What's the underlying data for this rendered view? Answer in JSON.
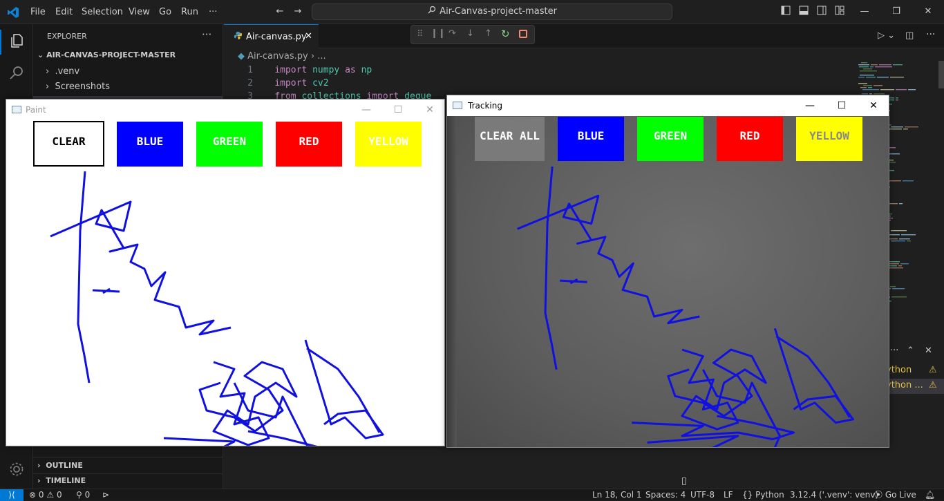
{
  "menu": [
    "File",
    "Edit",
    "Selection",
    "View",
    "Go",
    "Run",
    "···"
  ],
  "command_center": "Air-Canvas-project-master",
  "explorer": {
    "title": "EXPLORER",
    "project": "AIR-CANVAS-PROJECT-MASTER",
    "items": [
      ".venv",
      "Screenshots"
    ],
    "outline": "OUTLINE",
    "timeline": "TIMELINE"
  },
  "editor": {
    "tab_label": "Air-canvas.py",
    "breadcrumb_file": "Air-canvas.py",
    "breadcrumb_more": "...",
    "lines": [
      {
        "n": "1",
        "tokens": [
          [
            "kw",
            "import"
          ],
          [
            "t",
            " "
          ],
          [
            "md",
            "numpy"
          ],
          [
            "t",
            " "
          ],
          [
            "kw",
            "as"
          ],
          [
            "t",
            " "
          ],
          [
            "md",
            "np"
          ]
        ]
      },
      {
        "n": "2",
        "tokens": [
          [
            "kw",
            "import"
          ],
          [
            "t",
            " "
          ],
          [
            "md",
            "cv2"
          ]
        ]
      },
      {
        "n": "3",
        "tokens": [
          [
            "kw",
            "from"
          ],
          [
            "t",
            " "
          ],
          [
            "md",
            "collections"
          ],
          [
            "t",
            " "
          ],
          [
            "kw",
            "import"
          ],
          [
            "t",
            " "
          ],
          [
            "md",
            "deque"
          ]
        ]
      }
    ]
  },
  "panel": {
    "item1": "ython",
    "item2": "ython ..."
  },
  "paint_window": {
    "title": "Paint",
    "buttons": [
      {
        "label": "CLEAR",
        "bg": "#ffffff",
        "fg": "#000000"
      },
      {
        "label": "BLUE",
        "bg": "#0000ff",
        "fg": "#ffffff"
      },
      {
        "label": "GREEN",
        "bg": "#00ff00",
        "fg": "#ffffff"
      },
      {
        "label": "RED",
        "bg": "#ff0000",
        "fg": "#ffffff"
      },
      {
        "label": "YELLOW",
        "bg": "#ffff00",
        "fg": "#ffffff"
      }
    ]
  },
  "tracking_window": {
    "title": "Tracking",
    "buttons": [
      {
        "label": "CLEAR ALL",
        "bg": "#7a7a7a",
        "fg": "#ffffff"
      },
      {
        "label": "BLUE",
        "bg": "#0000ff",
        "fg": "#ffffff"
      },
      {
        "label": "GREEN",
        "bg": "#00ff00",
        "fg": "#ffffff"
      },
      {
        "label": "RED",
        "bg": "#ff0000",
        "fg": "#ffffff"
      },
      {
        "label": "YELLOW",
        "bg": "#ffff00",
        "fg": "#8a8a8a"
      }
    ]
  },
  "stroke_color": "#1010e0",
  "status": {
    "errors": "0",
    "warnings": "0",
    "ports": "0",
    "position": "Ln 18, Col 1",
    "spaces": "Spaces: 4",
    "encoding": "UTF-8",
    "eol": "LF",
    "language": "Python",
    "interpreter": "3.12.4 ('.venv': venv)",
    "golive": "Go Live"
  },
  "accent": "#0078d4"
}
